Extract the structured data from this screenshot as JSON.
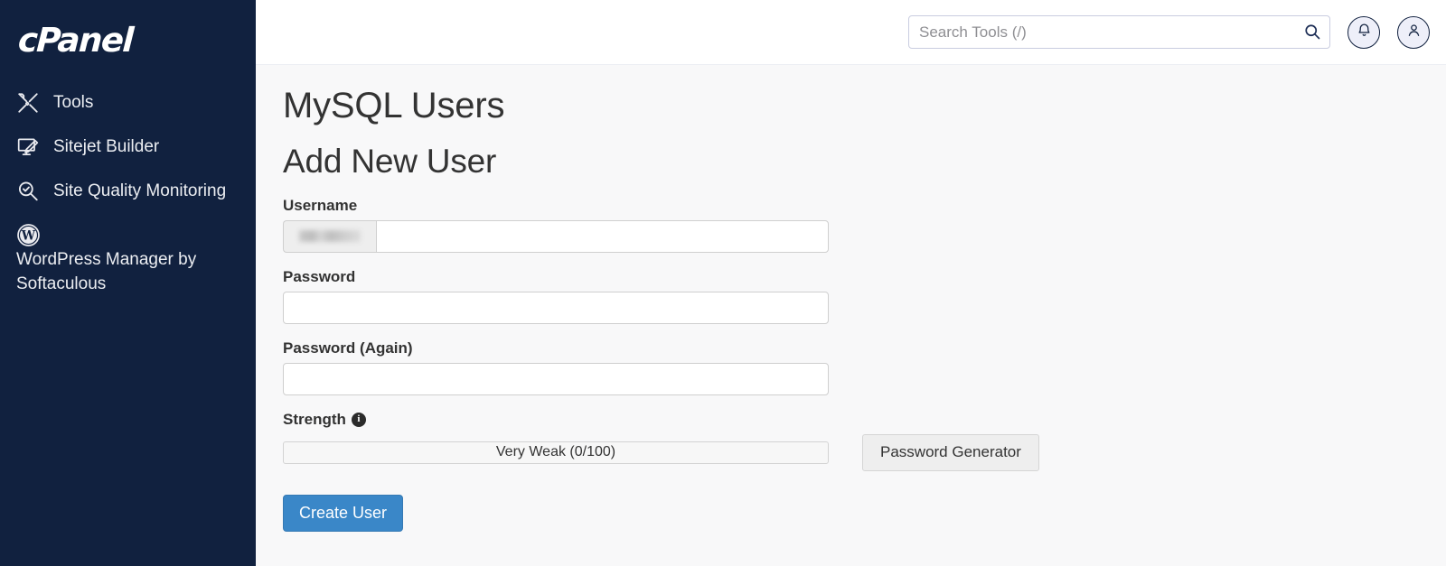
{
  "sidebar": {
    "logo_text": "cPanel",
    "items": [
      {
        "label": "Tools",
        "icon": "tools-icon"
      },
      {
        "label": "Sitejet Builder",
        "icon": "monitor-pen-icon"
      },
      {
        "label": "Site Quality Monitoring",
        "icon": "magnifier-check-icon"
      },
      {
        "label": "WordPress Manager by Softaculous",
        "icon": "wordpress-icon"
      }
    ]
  },
  "header": {
    "search_placeholder": "Search Tools (/)",
    "search_value": "",
    "search_icon": "search-icon",
    "notifications_icon": "bell-icon",
    "account_icon": "user-icon"
  },
  "main": {
    "page_title": "MySQL Users",
    "section_title": "Add New User",
    "fields": {
      "username": {
        "label": "Username",
        "prefix": "",
        "value": "",
        "placeholder": ""
      },
      "password": {
        "label": "Password",
        "value": "",
        "placeholder": ""
      },
      "password_again": {
        "label": "Password (Again)",
        "value": "",
        "placeholder": ""
      }
    },
    "strength": {
      "label": "Strength",
      "info_icon": "info-icon",
      "info_glyph": "i",
      "value_text": "Very Weak (0/100)",
      "score": 0,
      "max_score": 100
    },
    "password_generator_label": "Password Generator",
    "create_user_label": "Create User"
  },
  "colors": {
    "sidebar_bg": "#11213f",
    "main_bg": "#f8f8f9",
    "primary_button": "#3a87c8",
    "header_bg": "#ffffff"
  }
}
